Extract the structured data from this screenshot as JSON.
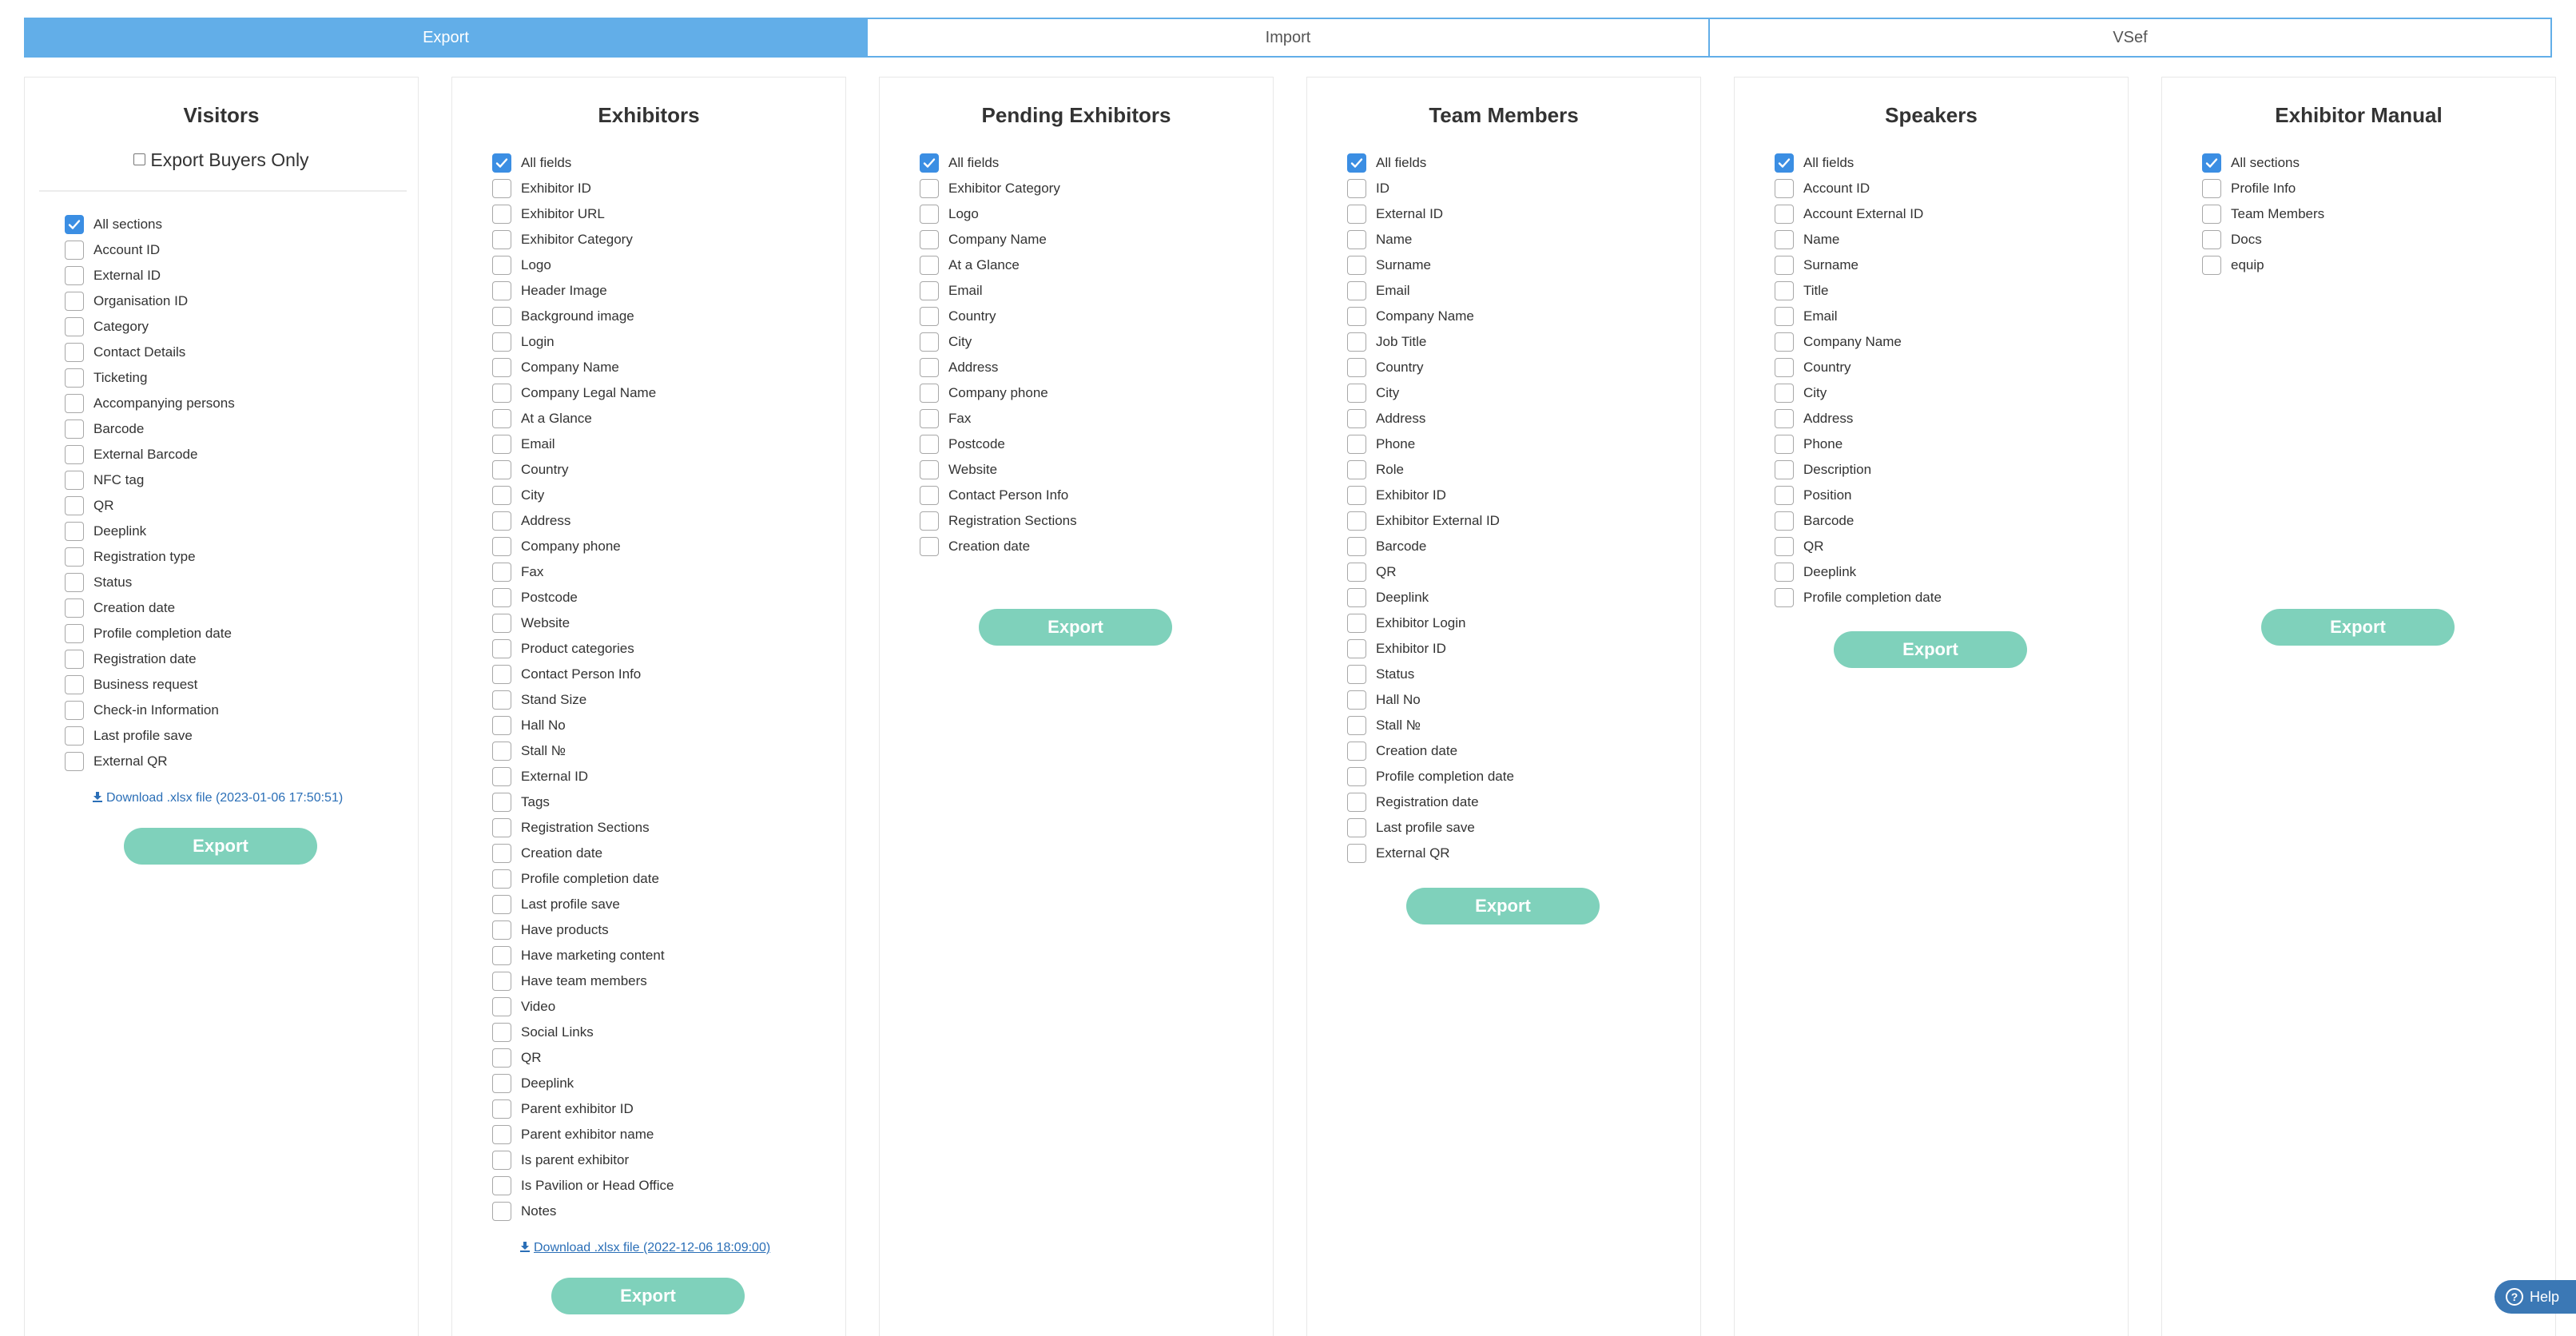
{
  "tabs": [
    {
      "label": "Export",
      "active": true
    },
    {
      "label": "Import",
      "active": false
    },
    {
      "label": "VSef",
      "active": false
    }
  ],
  "colors": {
    "accent": "#62aee8",
    "checkbox": "#3b8ee3",
    "export_button": "#7fd1bb",
    "link": "#2b6fb7",
    "help": "#3b78b5"
  },
  "visitors": {
    "title": "Visitors",
    "buyers_label": "Export Buyers Only",
    "items": [
      {
        "label": "All sections",
        "checked": true
      },
      {
        "label": "Account ID",
        "checked": false
      },
      {
        "label": "External ID",
        "checked": false
      },
      {
        "label": "Organisation ID",
        "checked": false
      },
      {
        "label": "Category",
        "checked": false
      },
      {
        "label": "Contact Details",
        "checked": false
      },
      {
        "label": "Ticketing",
        "checked": false
      },
      {
        "label": "Accompanying persons",
        "checked": false
      },
      {
        "label": "Barcode",
        "checked": false
      },
      {
        "label": "External Barcode",
        "checked": false
      },
      {
        "label": "NFC tag",
        "checked": false
      },
      {
        "label": "QR",
        "checked": false
      },
      {
        "label": "Deeplink",
        "checked": false
      },
      {
        "label": "Registration type",
        "checked": false
      },
      {
        "label": "Status",
        "checked": false
      },
      {
        "label": "Creation date",
        "checked": false
      },
      {
        "label": "Profile completion date",
        "checked": false
      },
      {
        "label": "Registration date",
        "checked": false
      },
      {
        "label": "Business request",
        "checked": false
      },
      {
        "label": "Check-in Information",
        "checked": false
      },
      {
        "label": "Last profile save",
        "checked": false
      },
      {
        "label": "External QR",
        "checked": false
      }
    ],
    "download": "Download .xlsx file (2023-01-06 17:50:51)",
    "export": "Export"
  },
  "exhibitors": {
    "title": "Exhibitors",
    "items": [
      {
        "label": "All fields",
        "checked": true
      },
      {
        "label": "Exhibitor ID",
        "checked": false
      },
      {
        "label": "Exhibitor URL",
        "checked": false
      },
      {
        "label": "Exhibitor Category",
        "checked": false
      },
      {
        "label": "Logo",
        "checked": false
      },
      {
        "label": "Header Image",
        "checked": false
      },
      {
        "label": "Background image",
        "checked": false
      },
      {
        "label": "Login",
        "checked": false
      },
      {
        "label": "Company Name",
        "checked": false
      },
      {
        "label": "Company Legal Name",
        "checked": false
      },
      {
        "label": "At a Glance",
        "checked": false
      },
      {
        "label": "Email",
        "checked": false
      },
      {
        "label": "Country",
        "checked": false
      },
      {
        "label": "City",
        "checked": false
      },
      {
        "label": "Address",
        "checked": false
      },
      {
        "label": "Company phone",
        "checked": false
      },
      {
        "label": "Fax",
        "checked": false
      },
      {
        "label": "Postcode",
        "checked": false
      },
      {
        "label": "Website",
        "checked": false
      },
      {
        "label": "Product categories",
        "checked": false
      },
      {
        "label": "Contact Person Info",
        "checked": false
      },
      {
        "label": "Stand Size",
        "checked": false
      },
      {
        "label": "Hall No",
        "checked": false
      },
      {
        "label": "Stall №",
        "checked": false
      },
      {
        "label": "External ID",
        "checked": false
      },
      {
        "label": "Tags",
        "checked": false
      },
      {
        "label": "Registration Sections",
        "checked": false
      },
      {
        "label": "Creation date",
        "checked": false
      },
      {
        "label": "Profile completion date",
        "checked": false
      },
      {
        "label": "Last profile save",
        "checked": false
      },
      {
        "label": "Have products",
        "checked": false
      },
      {
        "label": "Have marketing content",
        "checked": false
      },
      {
        "label": "Have team members",
        "checked": false
      },
      {
        "label": "Video",
        "checked": false
      },
      {
        "label": "Social Links",
        "checked": false
      },
      {
        "label": "QR",
        "checked": false
      },
      {
        "label": "Deeplink",
        "checked": false
      },
      {
        "label": "Parent exhibitor ID",
        "checked": false
      },
      {
        "label": "Parent exhibitor name",
        "checked": false
      },
      {
        "label": "Is parent exhibitor",
        "checked": false
      },
      {
        "label": "Is Pavilion or Head Office",
        "checked": false
      },
      {
        "label": "Notes",
        "checked": false
      }
    ],
    "download": "Download .xlsx file (2022-12-06 18:09:00)",
    "export": "Export"
  },
  "pending": {
    "title": "Pending Exhibitors",
    "items": [
      {
        "label": "All fields",
        "checked": true
      },
      {
        "label": "Exhibitor Category",
        "checked": false
      },
      {
        "label": "Logo",
        "checked": false
      },
      {
        "label": "Company Name",
        "checked": false
      },
      {
        "label": "At a Glance",
        "checked": false
      },
      {
        "label": "Email",
        "checked": false
      },
      {
        "label": "Country",
        "checked": false
      },
      {
        "label": "City",
        "checked": false
      },
      {
        "label": "Address",
        "checked": false
      },
      {
        "label": "Company phone",
        "checked": false
      },
      {
        "label": "Fax",
        "checked": false
      },
      {
        "label": "Postcode",
        "checked": false
      },
      {
        "label": "Website",
        "checked": false
      },
      {
        "label": "Contact Person Info",
        "checked": false
      },
      {
        "label": "Registration Sections",
        "checked": false
      },
      {
        "label": "Creation date",
        "checked": false
      }
    ],
    "export": "Export"
  },
  "team": {
    "title": "Team Members",
    "items": [
      {
        "label": "All fields",
        "checked": true
      },
      {
        "label": "ID",
        "checked": false
      },
      {
        "label": "External ID",
        "checked": false
      },
      {
        "label": "Name",
        "checked": false
      },
      {
        "label": "Surname",
        "checked": false
      },
      {
        "label": "Email",
        "checked": false
      },
      {
        "label": "Company Name",
        "checked": false
      },
      {
        "label": "Job Title",
        "checked": false
      },
      {
        "label": "Country",
        "checked": false
      },
      {
        "label": "City",
        "checked": false
      },
      {
        "label": "Address",
        "checked": false
      },
      {
        "label": "Phone",
        "checked": false
      },
      {
        "label": "Role",
        "checked": false
      },
      {
        "label": "Exhibitor ID",
        "checked": false
      },
      {
        "label": "Exhibitor External ID",
        "checked": false
      },
      {
        "label": "Barcode",
        "checked": false
      },
      {
        "label": "QR",
        "checked": false
      },
      {
        "label": "Deeplink",
        "checked": false
      },
      {
        "label": "Exhibitor Login",
        "checked": false
      },
      {
        "label": "Exhibitor ID",
        "checked": false
      },
      {
        "label": "Status",
        "checked": false
      },
      {
        "label": "Hall No",
        "checked": false
      },
      {
        "label": "Stall №",
        "checked": false
      },
      {
        "label": "Creation date",
        "checked": false
      },
      {
        "label": "Profile completion date",
        "checked": false
      },
      {
        "label": "Registration date",
        "checked": false
      },
      {
        "label": "Last profile save",
        "checked": false
      },
      {
        "label": "External QR",
        "checked": false
      }
    ],
    "export": "Export"
  },
  "speakers": {
    "title": "Speakers",
    "items": [
      {
        "label": "All fields",
        "checked": true
      },
      {
        "label": "Account ID",
        "checked": false
      },
      {
        "label": "Account External ID",
        "checked": false
      },
      {
        "label": "Name",
        "checked": false
      },
      {
        "label": "Surname",
        "checked": false
      },
      {
        "label": "Title",
        "checked": false
      },
      {
        "label": "Email",
        "checked": false
      },
      {
        "label": "Company Name",
        "checked": false
      },
      {
        "label": "Country",
        "checked": false
      },
      {
        "label": "City",
        "checked": false
      },
      {
        "label": "Address",
        "checked": false
      },
      {
        "label": "Phone",
        "checked": false
      },
      {
        "label": "Description",
        "checked": false
      },
      {
        "label": "Position",
        "checked": false
      },
      {
        "label": "Barcode",
        "checked": false
      },
      {
        "label": "QR",
        "checked": false
      },
      {
        "label": "Deeplink",
        "checked": false
      },
      {
        "label": "Profile completion date",
        "checked": false
      }
    ],
    "export": "Export"
  },
  "manual": {
    "title": "Exhibitor Manual",
    "items": [
      {
        "label": "All sections",
        "checked": true
      },
      {
        "label": "Profile Info",
        "checked": false
      },
      {
        "label": "Team Members",
        "checked": false
      },
      {
        "label": "Docs",
        "checked": false
      },
      {
        "label": "equip",
        "checked": false
      }
    ],
    "export": "Export"
  },
  "help": {
    "label": "Help"
  }
}
